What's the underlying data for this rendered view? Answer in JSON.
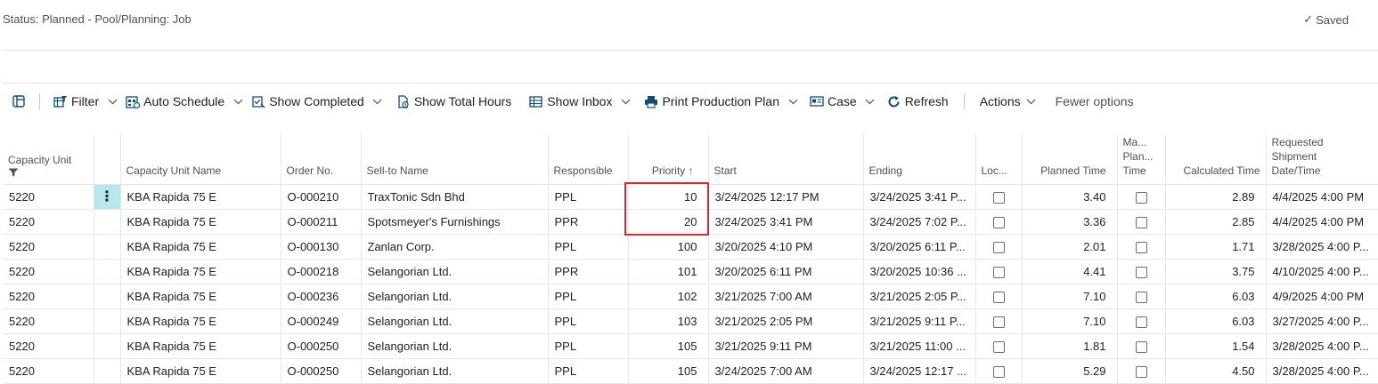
{
  "status": {
    "text": "Status: Planned - Pool/Planning: Job",
    "saved_label": "Saved"
  },
  "toolbar": {
    "filter": "Filter",
    "auto_schedule": "Auto Schedule",
    "show_completed": "Show Completed",
    "show_total_hours": "Show Total Hours",
    "show_inbox": "Show Inbox",
    "print_production_plan": "Print Production Plan",
    "case": "Case",
    "refresh": "Refresh",
    "actions": "Actions",
    "fewer_options": "Fewer options"
  },
  "table": {
    "headers": {
      "capacity_unit": "Capacity Unit",
      "capacity_unit_name": "Capacity Unit Name",
      "order_no": "Order No.",
      "sell_to_name": "Sell-to Name",
      "responsible": "Responsible",
      "priority": "Priority",
      "start": "Start",
      "ending": "Ending",
      "locked": "Loc...",
      "planned_time": "Planned Time",
      "manual_plan_time_1": "Ma...",
      "manual_plan_time_2": "Plan...",
      "manual_plan_time_3": "Time",
      "calculated_time": "Calculated Time",
      "requested_shipment_1": "Requested",
      "requested_shipment_2": "Shipment",
      "requested_shipment_3": "Date/Time"
    },
    "rows": [
      {
        "capacity_unit": "5220",
        "name": "KBA Rapida 75 E",
        "order_no": "O-000210",
        "sell_to": "TraxTonic Sdn Bhd",
        "responsible": "PPL",
        "priority": "10",
        "start": "3/24/2025 12:17 PM",
        "ending": "3/24/2025 3:41 P...",
        "planned": "3.40",
        "calculated": "2.89",
        "requested": "4/4/2025 4:00 PM"
      },
      {
        "capacity_unit": "5220",
        "name": "KBA Rapida 75 E",
        "order_no": "O-000211",
        "sell_to": "Spotsmeyer's Furnishings",
        "responsible": "PPR",
        "priority": "20",
        "start": "3/24/2025 3:41 PM",
        "ending": "3/24/2025 7:02 P...",
        "planned": "3.36",
        "calculated": "2.85",
        "requested": "4/4/2025 4:00 PM"
      },
      {
        "capacity_unit": "5220",
        "name": "KBA Rapida 75 E",
        "order_no": "O-000130",
        "sell_to": "Zanlan Corp.",
        "responsible": "PPL",
        "priority": "100",
        "start": "3/20/2025 4:10 PM",
        "ending": "3/20/2025 6:11 P...",
        "planned": "2.01",
        "calculated": "1.71",
        "requested": "3/28/2025 4:00 P..."
      },
      {
        "capacity_unit": "5220",
        "name": "KBA Rapida 75 E",
        "order_no": "O-000218",
        "sell_to": "Selangorian Ltd.",
        "responsible": "PPR",
        "priority": "101",
        "start": "3/20/2025 6:11 PM",
        "ending": "3/20/2025 10:36 ...",
        "planned": "4.41",
        "calculated": "3.75",
        "requested": "4/10/2025 4:00 P..."
      },
      {
        "capacity_unit": "5220",
        "name": "KBA Rapida 75 E",
        "order_no": "O-000236",
        "sell_to": "Selangorian Ltd.",
        "responsible": "PPL",
        "priority": "102",
        "start": "3/21/2025 7:00 AM",
        "ending": "3/21/2025 2:05 P...",
        "planned": "7.10",
        "calculated": "6.03",
        "requested": "4/9/2025 4:00 PM"
      },
      {
        "capacity_unit": "5220",
        "name": "KBA Rapida 75 E",
        "order_no": "O-000249",
        "sell_to": "Selangorian Ltd.",
        "responsible": "PPL",
        "priority": "103",
        "start": "3/21/2025 2:05 PM",
        "ending": "3/21/2025 9:11 P...",
        "planned": "7.10",
        "calculated": "6.03",
        "requested": "3/27/2025 4:00 P..."
      },
      {
        "capacity_unit": "5220",
        "name": "KBA Rapida 75 E",
        "order_no": "O-000250",
        "sell_to": "Selangorian Ltd.",
        "responsible": "PPL",
        "priority": "105",
        "start": "3/21/2025 9:11 PM",
        "ending": "3/21/2025 11:00 ...",
        "planned": "1.81",
        "calculated": "1.54",
        "requested": "3/28/2025 4:00 P..."
      },
      {
        "capacity_unit": "5220",
        "name": "KBA Rapida 75 E",
        "order_no": "O-000250",
        "sell_to": "Selangorian Ltd.",
        "responsible": "PPL",
        "priority": "105",
        "start": "3/24/2025 7:00 AM",
        "ending": "3/24/2025 12:17 ...",
        "planned": "5.29",
        "calculated": "4.50",
        "requested": "3/28/2025 4:00 P..."
      }
    ]
  },
  "colors": {
    "selected_cell": "#b8e6ec",
    "highlight_border": "#d62b2b",
    "icon": "#0e4f6e"
  }
}
